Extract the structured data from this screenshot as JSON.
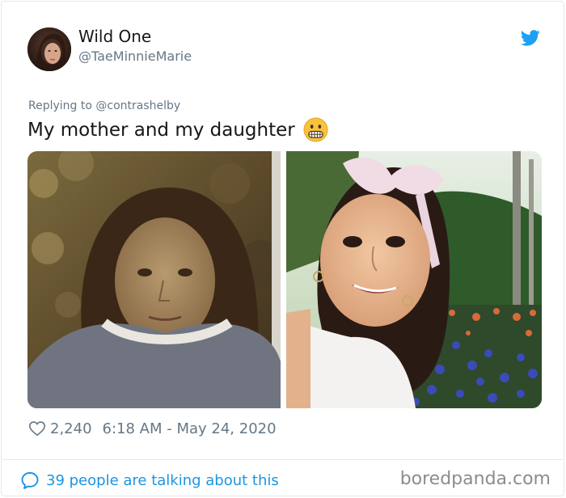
{
  "author": {
    "display_name": "Wild One",
    "handle": "@TaeMinnieMarie"
  },
  "reply": {
    "prefix": "Replying to",
    "mention": "@contrashelby"
  },
  "tweet": {
    "text": "My mother and my daughter",
    "emoji": "grimacing-face-emoji"
  },
  "photos": [
    {
      "name": "mother-childhood-photo"
    },
    {
      "name": "daughter-selfie-photo"
    }
  ],
  "meta": {
    "likes": "2,240",
    "timestamp": "6:18 AM - May 24, 2020"
  },
  "footer": {
    "conversation": "39 people are talking about this",
    "watermark": "boredpanda.com"
  },
  "colors": {
    "twitter_blue": "#1da1f2",
    "link_blue": "#1b95e0",
    "muted_gray": "#657786",
    "text_dark": "#14171a",
    "border": "#e1e8ed"
  },
  "icons": {
    "bird": "twitter-bird-icon",
    "heart": "heart-outline-icon",
    "bubble": "speech-bubble-icon"
  }
}
